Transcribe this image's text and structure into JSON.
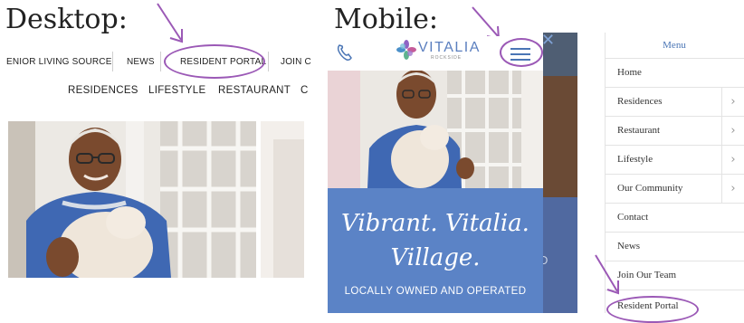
{
  "desktop": {
    "heading": "Desktop:",
    "topnav": [
      "ENIOR LIVING SOURCE",
      "NEWS",
      "RESIDENT PORTAL",
      "JOIN C"
    ],
    "mainnav": [
      "RESIDENCES",
      "LIFESTYLE",
      "RESTAURANT",
      "C"
    ]
  },
  "mobile": {
    "heading": "Mobile:",
    "logo_text": "VITALIA",
    "logo_sub": "ROCKSIDE",
    "hero_line1": "Vibrant. Vitalia.",
    "hero_line2": "Village.",
    "tagline": "LOCALLY OWNED AND OPERATED",
    "partial_text": "D"
  },
  "menu": {
    "title": "Menu",
    "items": [
      "Home",
      "Residences",
      "Restaurant",
      "Lifestyle",
      "Our Community",
      "Contact",
      "News",
      "Join Our Team",
      "Resident Portal"
    ],
    "chevron": "›",
    "close": "✕"
  },
  "colors": {
    "accent": "#9b59b6",
    "hero_blue": "#5b83c6",
    "menu_title": "#4a75b5"
  },
  "icons": [
    "phone-icon",
    "hamburger-icon",
    "close-icon",
    "chevron-right-icon",
    "arrow-annotation"
  ]
}
